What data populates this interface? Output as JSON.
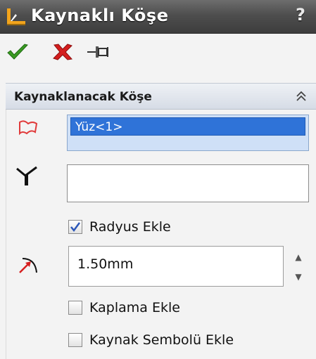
{
  "window": {
    "title": "Kaynaklı Köşe",
    "help_label": "?"
  },
  "toolbar": {
    "ok_icon": "green-check",
    "cancel_icon": "red-x",
    "pin_icon": "push-pin"
  },
  "section": {
    "title": "Kaynaklanacak Köşe",
    "collapse_icon": "double-chevron-up"
  },
  "faces": {
    "items": [
      "Yüz<1>"
    ]
  },
  "edges": {
    "items": []
  },
  "add_radius": {
    "label": "Radyus Ekle",
    "checked": true
  },
  "radius": {
    "value": "1.50mm"
  },
  "add_texture": {
    "label": "Kaplama Ekle",
    "checked": false
  },
  "add_weld_symbol": {
    "label": "Kaynak Sembolü Ekle",
    "checked": false
  },
  "colors": {
    "selection": "#2f73d8",
    "title_bar": "#4e4e4e",
    "ok": "#3a9a22",
    "cancel": "#d41e1e"
  }
}
